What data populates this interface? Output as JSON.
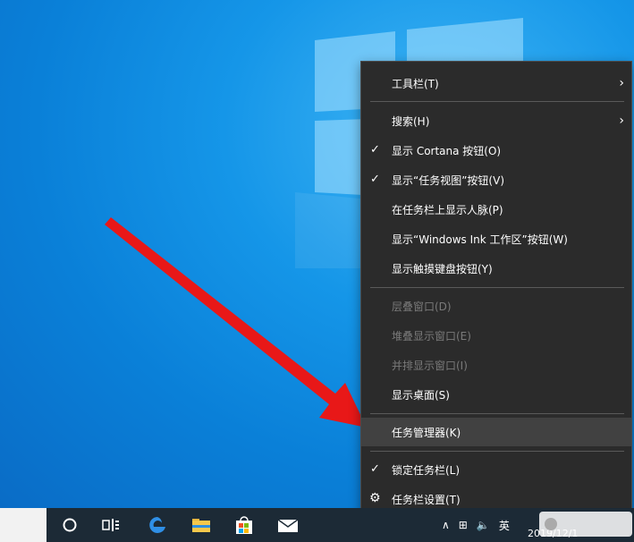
{
  "menu": {
    "items": [
      {
        "label": "工具栏(T)",
        "checked": false,
        "submenu": true,
        "disabled": false
      },
      {
        "label": "搜索(H)",
        "checked": false,
        "submenu": true,
        "disabled": false
      },
      {
        "label": "显示 Cortana 按钮(O)",
        "checked": true,
        "submenu": false,
        "disabled": false
      },
      {
        "label": "显示“任务视图”按钮(V)",
        "checked": true,
        "submenu": false,
        "disabled": false
      },
      {
        "label": "在任务栏上显示人脉(P)",
        "checked": false,
        "submenu": false,
        "disabled": false
      },
      {
        "label": "显示“Windows Ink 工作区”按钮(W)",
        "checked": false,
        "submenu": false,
        "disabled": false
      },
      {
        "label": "显示触摸键盘按钮(Y)",
        "checked": false,
        "submenu": false,
        "disabled": false
      },
      {
        "label": "层叠窗口(D)",
        "checked": false,
        "submenu": false,
        "disabled": true
      },
      {
        "label": "堆叠显示窗口(E)",
        "checked": false,
        "submenu": false,
        "disabled": true
      },
      {
        "label": "并排显示窗口(I)",
        "checked": false,
        "submenu": false,
        "disabled": true
      },
      {
        "label": "显示桌面(S)",
        "checked": false,
        "submenu": false,
        "disabled": false
      },
      {
        "label": "任务管理器(K)",
        "checked": false,
        "submenu": false,
        "disabled": false,
        "highlighted": true
      },
      {
        "label": "锁定任务栏(L)",
        "checked": true,
        "submenu": false,
        "disabled": false
      },
      {
        "label": "任务栏设置(T)",
        "checked": false,
        "submenu": false,
        "disabled": false,
        "icon": "gear-icon"
      }
    ]
  },
  "taskbar": {
    "icons": [
      "cortana-icon",
      "task-view-icon",
      "edge-icon",
      "file-explorer-icon",
      "store-icon",
      "mail-icon"
    ],
    "tray": {
      "ime": "英",
      "date": "2019/12/1"
    }
  },
  "colors": {
    "menu_bg": "#2b2b2b",
    "highlight": "#414141",
    "arrow": "#e81818",
    "taskbar": "#1c2a36"
  }
}
